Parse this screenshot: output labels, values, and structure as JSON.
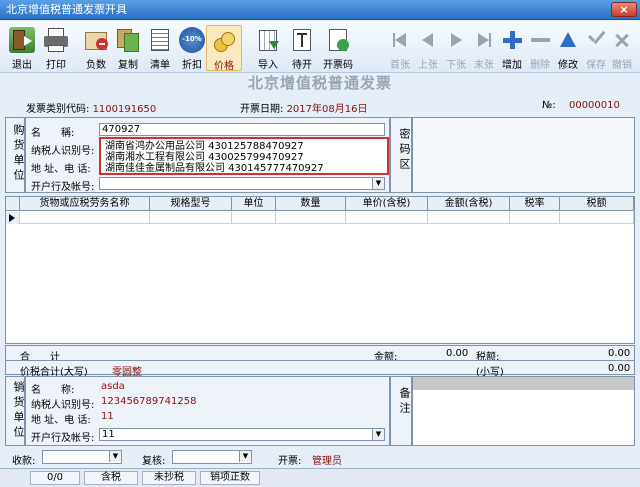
{
  "window": {
    "title": "北京增值税普通发票开具",
    "close_label": "×"
  },
  "toolbar": {
    "left": [
      {
        "label": "退出",
        "icon": "exit-icon"
      },
      {
        "label": "打印",
        "icon": "printer-icon"
      },
      {
        "label": "负数",
        "icon": "negative-icon"
      },
      {
        "label": "复制",
        "icon": "copy-icon"
      },
      {
        "label": "清单",
        "icon": "list-icon"
      },
      {
        "label": "折扣",
        "icon": "discount-icon",
        "badge": "-10%"
      },
      {
        "label": "价格",
        "icon": "price-icon"
      },
      {
        "label": "导入",
        "icon": "import-icon"
      },
      {
        "label": "待开",
        "icon": "pending-icon"
      },
      {
        "label": "开票码",
        "icon": "invoice-code-icon"
      }
    ],
    "right": [
      {
        "label": "首张",
        "icon": "first-icon",
        "enabled": false
      },
      {
        "label": "上张",
        "icon": "prev-icon",
        "enabled": false
      },
      {
        "label": "下张",
        "icon": "next-icon",
        "enabled": false
      },
      {
        "label": "末张",
        "icon": "last-icon",
        "enabled": false
      },
      {
        "label": "增加",
        "icon": "add-icon",
        "enabled": true
      },
      {
        "label": "删除",
        "icon": "delete-icon",
        "enabled": false
      },
      {
        "label": "修改",
        "icon": "edit-icon",
        "enabled": true
      },
      {
        "label": "保存",
        "icon": "save-icon",
        "enabled": false
      },
      {
        "label": "撤销",
        "icon": "undo-icon",
        "enabled": false
      }
    ]
  },
  "invoice": {
    "heading": "北京增值税普通发票",
    "type_code_label": "发票类别代码:",
    "type_code": "1100191650",
    "date_label": "开票日期:",
    "date": "2017年08月16日",
    "no_label": "№:",
    "no": "00000010"
  },
  "buyer": {
    "section_label": "购货单位",
    "name_label": "名　　稱:",
    "name_value": "470927",
    "taxid_label": "纳税人识别号:",
    "address_label": "地 址、电 话:",
    "bank_label": "开户行及帐号:",
    "suggestions": [
      "湖南省鸿办公用品公司 430125788470927",
      "湖南湘水工程有限公司 430025799470927",
      "湖南佳佳金属制品有限公司 430145777470927"
    ]
  },
  "password_area_label": "密码区",
  "table": {
    "headers": [
      "货物或应税劳务名称",
      "规格型号",
      "单位",
      "数量",
      "单价(含税)",
      "金额(含税)",
      "税率",
      "税额"
    ]
  },
  "totals": {
    "sum_label": "合　　计",
    "amount_label": "金额:",
    "amount": "0.00",
    "tax_label": "税额:",
    "tax": "0.00",
    "total_label": "价税合计(大写)",
    "total_upper": "零圆整",
    "small_label": "(小写)",
    "small": "0.00"
  },
  "seller": {
    "section_label": "销货单位",
    "name_label": "名　　称:",
    "name_value": "asda",
    "taxid_label": "纳税人识别号:",
    "taxid_value": "123456789741258",
    "address_label": "地 址、电 话:",
    "address_value": "11",
    "bank_label": "开户行及帐号:",
    "bank_value": "11"
  },
  "remark_label": "备注",
  "footer": {
    "receiver_label": "收款:",
    "reviewer_label": "复核:",
    "issuer_label": "开票:",
    "issuer_value": "管理员"
  },
  "statusbar": {
    "count": "0/0",
    "tax_included": "含税",
    "unreported": "未抄税",
    "sales_item": "销项正数"
  },
  "colors": {
    "accent_red": "#d03030",
    "title_blue": "#2a6fc4"
  }
}
